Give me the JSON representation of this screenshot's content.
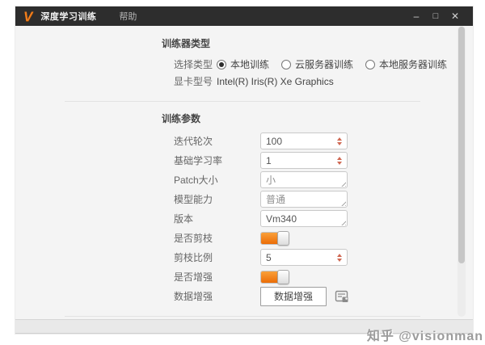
{
  "window": {
    "logo": "V",
    "title": "深度学习训练",
    "menu_help": "帮助",
    "controls": {
      "minimize": "–",
      "maximize": "□",
      "close": "✕"
    }
  },
  "trainer_section": {
    "header": "训练器类型",
    "type_row": {
      "label": "选择类型",
      "options": [
        {
          "label": "本地训练",
          "selected": true
        },
        {
          "label": "云服务器训练",
          "selected": false
        },
        {
          "label": "本地服务器训练",
          "selected": false
        }
      ]
    },
    "gpu_row": {
      "label": "显卡型号",
      "value": "Intel(R) Iris(R) Xe Graphics"
    }
  },
  "params_section": {
    "header": "训练参数",
    "iterations": {
      "label": "迭代轮次",
      "value": "100"
    },
    "learning_rate": {
      "label": "基础学习率",
      "value": "1"
    },
    "patch_size": {
      "label": "Patch大小",
      "value": "小"
    },
    "model_capacity": {
      "label": "模型能力",
      "value": "普通"
    },
    "version": {
      "label": "版本",
      "value": "Vm340"
    },
    "prune_toggle": {
      "label": "是否剪枝",
      "state": "on"
    },
    "prune_ratio": {
      "label": "剪枝比例",
      "value": "5"
    },
    "augment_toggle": {
      "label": "是否增强",
      "state": "on"
    },
    "augment_row": {
      "label": "数据增强",
      "button_label": "数据增强",
      "icon": "data-preview-icon"
    }
  },
  "watermark": "知乎 @visionman",
  "colors": {
    "accent_orange": "#ee7011",
    "titlebar": "#2d2d2d",
    "spinner_arrow": "#cf6853"
  }
}
